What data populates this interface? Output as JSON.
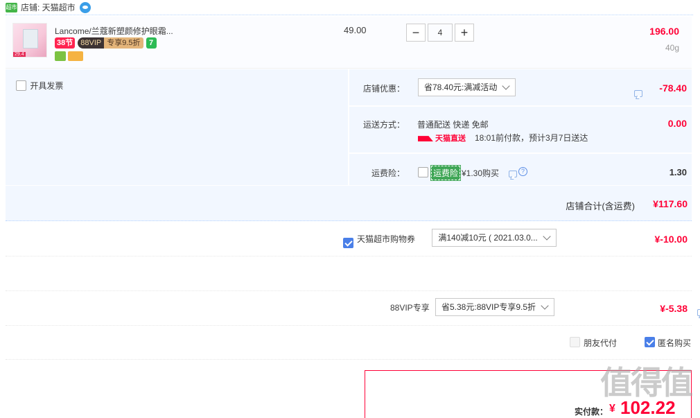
{
  "store": {
    "icon_text": "超市",
    "label": "店铺: 天猫超市"
  },
  "item": {
    "title": "Lancome/兰蔻新塑颜修护眼霜...",
    "thumb_badge": "29.4",
    "tag_38": "38节",
    "tag_vip": "88VIP",
    "tag_vip_discount": "专享9.5折",
    "tag_7": "7",
    "unit_price": "49.00",
    "quantity": "4",
    "minus": "−",
    "plus": "+",
    "subtotal": "196.00",
    "weight": "40g"
  },
  "invoice": {
    "label": "开具发票"
  },
  "store_discount": {
    "label": "店铺优惠：",
    "selected": "省78.40元:满减活动",
    "amount": "-78.40"
  },
  "shipping": {
    "label": "运送方式：",
    "method": "普通配送 快递 免邮",
    "tmall_direct": "天猫直送",
    "eta": "18:01前付款，预计3月7日送达",
    "amount": "0.00"
  },
  "shipping_insurance": {
    "label": "运费险：",
    "badge": "运费险",
    "price": "¥1.30购买",
    "help": "?",
    "amount": "1.30"
  },
  "store_total": {
    "label": "店铺合计(含运费)",
    "amount": "¥117.60"
  },
  "coupon": {
    "label": "天猫超市购物券",
    "selected": "满140减10元 ( 2021.03.0...",
    "amount": "¥-10.00"
  },
  "vip": {
    "label": "88VIP专享",
    "selected": "省5.38元:88VIP专享9.5折",
    "amount": "¥-5.38"
  },
  "options": {
    "friend_pay": "朋友代付",
    "anonymous": "匿名购买"
  },
  "payment": {
    "label": "实付款：",
    "currency": "¥",
    "amount": "102.22"
  },
  "watermark": "值得值",
  "colors": {
    "accent_red": "#ff0036",
    "panel_bg": "#f2f7ff",
    "checkbox_blue": "#4a7fe8",
    "tmall_green": "#44b549"
  }
}
